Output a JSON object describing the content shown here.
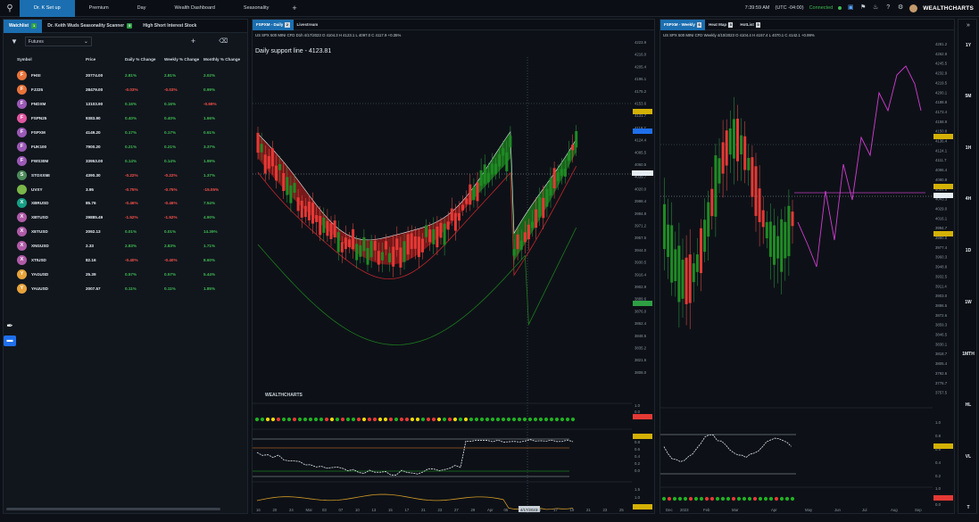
{
  "topbar": {
    "tabs": [
      {
        "label": "Dr. K Set up",
        "active": true
      },
      {
        "label": "Premium",
        "active": false
      },
      {
        "label": "Day",
        "active": false
      },
      {
        "label": "Wealth Dashboard",
        "active": false
      },
      {
        "label": "Seasonality",
        "active": false
      }
    ],
    "time": "7:39:59 AM",
    "timezone": "(UTC -04:00)",
    "status": "Connected",
    "logo": "WEALTHCHARTS"
  },
  "left_panel": {
    "tabs": [
      {
        "label": "Watchlist",
        "badge": "1",
        "active": true
      },
      {
        "label": "Dr. Keith Wuds Seasonality Scanner",
        "badge": "5",
        "active": false
      },
      {
        "label": "High Short Interest Stock",
        "badge": "",
        "active": false
      }
    ],
    "list_select": "Futures",
    "columns": {
      "symbol": "Symbol",
      "price": "Price",
      "daily": "Daily % Change",
      "weekly": "Weekly % Change",
      "monthly": "Monthly % Change"
    },
    "rows": [
      {
        "letter": "F",
        "color": "#e8743b",
        "symbol": "FHSI",
        "price": "20774.00",
        "daily": "2.81%",
        "weekly": "2.81%",
        "monthly": "2.02%",
        "d_sign": "pos",
        "w_sign": "pos",
        "m_sign": "pos"
      },
      {
        "letter": "F",
        "color": "#e8743b",
        "symbol": "FJ225",
        "price": "28479.00",
        "daily": "-0.03%",
        "weekly": "-0.03%",
        "monthly": "0.99%",
        "d_sign": "neg",
        "w_sign": "neg",
        "m_sign": "pos"
      },
      {
        "letter": "F",
        "color": "#9b59b6",
        "symbol": "FNDXM",
        "price": "13103.90",
        "daily": "0.16%",
        "weekly": "0.16%",
        "monthly": "-0.69%",
        "d_sign": "pos",
        "w_sign": "pos",
        "m_sign": "neg"
      },
      {
        "letter": "F",
        "color": "#e056a0",
        "symbol": "FSPN25",
        "price": "9383.90",
        "daily": "0.40%",
        "weekly": "0.40%",
        "monthly": "1.66%",
        "d_sign": "pos",
        "w_sign": "pos",
        "m_sign": "pos"
      },
      {
        "letter": "F",
        "color": "#9b59b6",
        "symbol": "FSPXM",
        "price": "4149.20",
        "daily": "0.17%",
        "weekly": "0.17%",
        "monthly": "0.61%",
        "d_sign": "pos",
        "w_sign": "pos",
        "m_sign": "pos"
      },
      {
        "letter": "F",
        "color": "#9b59b6",
        "symbol": "FUK100",
        "price": "7900.20",
        "daily": "0.21%",
        "weekly": "0.21%",
        "monthly": "3.37%",
        "d_sign": "pos",
        "w_sign": "pos",
        "m_sign": "pos"
      },
      {
        "letter": "F",
        "color": "#9b59b6",
        "symbol": "FWS30M",
        "price": "33953.00",
        "daily": "0.14%",
        "weekly": "0.14%",
        "monthly": "1.99%",
        "d_sign": "pos",
        "w_sign": "pos",
        "m_sign": "pos"
      },
      {
        "letter": "S",
        "color": "#4e8a5a",
        "symbol": "STOXX5E",
        "price": "4390.30",
        "daily": "-0.22%",
        "weekly": "-0.22%",
        "monthly": "1.37%",
        "d_sign": "neg",
        "w_sign": "neg",
        "m_sign": "pos"
      },
      {
        "letter": "",
        "color": "#7ab648",
        "symbol": "UVXY",
        "price": "3.95",
        "daily": "-0.75%",
        "weekly": "-0.75%",
        "monthly": "-15.05%",
        "d_sign": "neg",
        "w_sign": "neg",
        "m_sign": "neg"
      },
      {
        "letter": "X",
        "color": "#16a085",
        "symbol": "XBRUSD",
        "price": "85.76",
        "daily": "-0.46%",
        "weekly": "-0.46%",
        "monthly": "7.54%",
        "d_sign": "neg",
        "w_sign": "neg",
        "m_sign": "pos"
      },
      {
        "letter": "X",
        "color": "#b05ba8",
        "symbol": "XBTUSD",
        "price": "29885.49",
        "daily": "-1.52%",
        "weekly": "-1.52%",
        "monthly": "4.90%",
        "d_sign": "neg",
        "w_sign": "neg",
        "m_sign": "pos"
      },
      {
        "letter": "X",
        "color": "#b05ba8",
        "symbol": "XETUSD",
        "price": "2092.13",
        "daily": "0.01%",
        "weekly": "0.01%",
        "monthly": "14.39%",
        "d_sign": "pos",
        "w_sign": "pos",
        "m_sign": "pos"
      },
      {
        "letter": "X",
        "color": "#b05ba8",
        "symbol": "XNGUSD",
        "price": "2.33",
        "daily": "2.83%",
        "weekly": "2.83%",
        "monthly": "1.71%",
        "d_sign": "pos",
        "w_sign": "pos",
        "m_sign": "pos"
      },
      {
        "letter": "X",
        "color": "#b05ba8",
        "symbol": "XTIUSD",
        "price": "82.16",
        "daily": "-0.40%",
        "weekly": "-0.40%",
        "monthly": "8.60%",
        "d_sign": "neg",
        "w_sign": "neg",
        "m_sign": "pos"
      },
      {
        "letter": "Y",
        "color": "#e8a33b",
        "symbol": "YAGUSD",
        "price": "25.39",
        "daily": "0.57%",
        "weekly": "0.57%",
        "monthly": "5.44%",
        "d_sign": "pos",
        "w_sign": "pos",
        "m_sign": "pos"
      },
      {
        "letter": "Y",
        "color": "#e8a33b",
        "symbol": "YAUUSD",
        "price": "2007.57",
        "daily": "0.11%",
        "weekly": "0.11%",
        "monthly": "1.85%",
        "d_sign": "pos",
        "w_sign": "pos",
        "m_sign": "pos"
      }
    ]
  },
  "chart_a": {
    "tabs": [
      {
        "label": "FSPXM - Daily",
        "badge": "2",
        "active": true
      },
      {
        "label": "Livestream",
        "badge": "",
        "active": false
      }
    ],
    "info": "US SPX 500 MINI CFD  D1h  4/17/2023 O 4104.3 H 4123.1 L 4097.0 C 4117.9  +0.35%",
    "annotation": "Daily support line - 4123.81",
    "price_labels": [
      "4223.9",
      "4216.0",
      "4205.4",
      "4196.1",
      "4175.2",
      "4153.6",
      "4131.7",
      "4119.7",
      "4124.4",
      "4085.5",
      "4060.5",
      "4039.7",
      "4020.0",
      "3998.4",
      "3984.8",
      "3971.2",
      "3957.5",
      "3944.0",
      "3930.5",
      "3916.4",
      "3902.9",
      "3889.6",
      "3876.0",
      "3862.4",
      "3848.5",
      "3835.2",
      "3821.6",
      "3808.0"
    ],
    "date_labels": [
      "16",
      "20",
      "24",
      "Mar",
      "03",
      "07",
      "10",
      "13",
      "15",
      "17",
      "21",
      "23",
      "27",
      "29",
      "Apr",
      "05",
      "4/17/2023",
      "13",
      "17",
      "19",
      "21",
      "23",
      "25"
    ],
    "logo": "WEALTHCHARTS",
    "ind1_labels": [
      "1.0",
      "0.0",
      "0.0"
    ],
    "ind2_labels": [
      "1.0",
      "0.8",
      "0.6",
      "0.4",
      "0.2",
      "0.0"
    ],
    "ind3_labels": [
      "1.5",
      "1.0",
      "0.5"
    ]
  },
  "chart_b": {
    "tabs": [
      {
        "label": "FSPXM - Weekly",
        "badge": "6",
        "active": true
      },
      {
        "label": "Heat Map",
        "badge": "5",
        "active": false
      },
      {
        "label": "HotList",
        "badge": "5",
        "active": false
      }
    ],
    "info": "US SPX 500 MINI CFD  Weekly  4/10/2023 O 4104.4 H 4157.4 L 4070.1 C 4142.1  +0.99%",
    "price_labels": [
      "4281.2",
      "4262.8",
      "4245.5",
      "4232.9",
      "4219.5",
      "4200.1",
      "4188.8",
      "4173.4",
      "4158.9",
      "4150.8",
      "4136.4",
      "4124.1",
      "4111.7",
      "4096.4",
      "4080.8",
      "4054.6",
      "4043.3",
      "4029.0",
      "4016.1",
      "3994.7",
      "3990.0",
      "3977.4",
      "3960.3",
      "3948.8",
      "3932.5",
      "3911.4",
      "3903.0",
      "3886.5",
      "3872.6",
      "3859.3",
      "3846.5",
      "3830.1",
      "3818.7",
      "3805.4",
      "3792.6",
      "3776.7",
      "3757.5"
    ],
    "date_labels": [
      "Dec",
      "2023",
      "Feb",
      "Mar",
      "Apr",
      "May",
      "Jun",
      "Jul",
      "Aug",
      "Sep"
    ],
    "ind1_labels": [
      "1.0",
      "0.8",
      "0.6",
      "0.4",
      "0.2"
    ],
    "ind2_labels": [
      "1.0",
      "0.0",
      "0.0"
    ]
  },
  "timeframes": [
    "1Y",
    "5M",
    "1H",
    "4H",
    "1D",
    "1W",
    "1MTH",
    "HL",
    "VL",
    "T"
  ]
}
